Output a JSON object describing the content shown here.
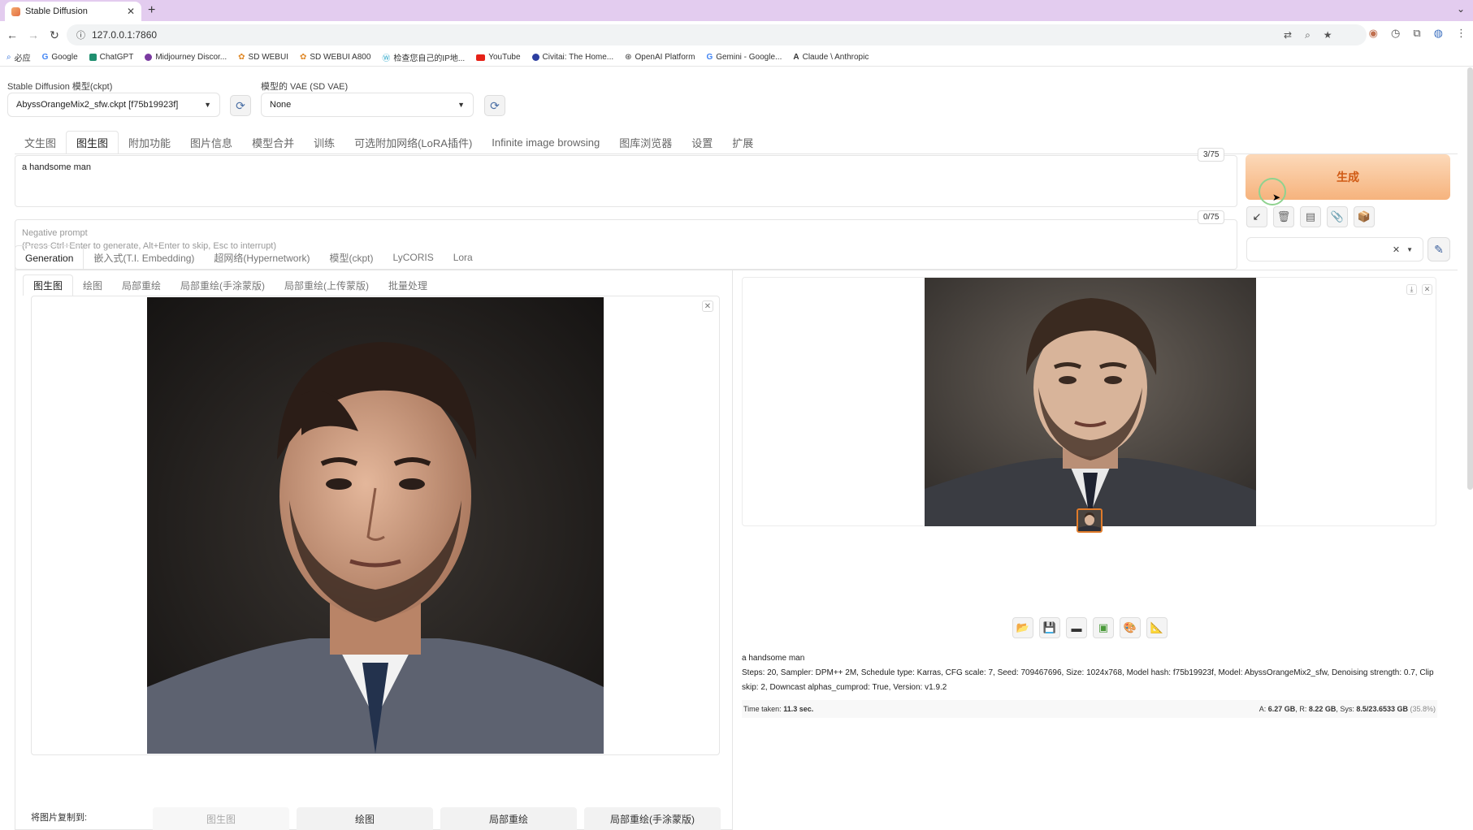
{
  "browser": {
    "tab_title": "Stable Diffusion",
    "url": "127.0.0.1:7860",
    "bookmarks": [
      "必应",
      "Google",
      "ChatGPT",
      "Midjourney Discor...",
      "SD WEBUI",
      "SD WEBUI A800",
      "检查您自己的IP地...",
      "YouTube",
      "Civitai: The Home...",
      "OpenAI Platform",
      "Gemini - Google...",
      "Claude \\ Anthropic"
    ]
  },
  "settings": {
    "model_label": "Stable Diffusion 模型(ckpt)",
    "model_value": "AbyssOrangeMix2_sfw.ckpt [f75b19923f]",
    "vae_label": "模型的 VAE (SD VAE)",
    "vae_value": "None"
  },
  "main_tabs": [
    "文生图",
    "图生图",
    "附加功能",
    "图片信息",
    "模型合并",
    "训练",
    "可选附加网络(LoRA插件)",
    "Infinite image browsing",
    "图库浏览器",
    "设置",
    "扩展"
  ],
  "prompt": {
    "text": "a handsome man",
    "counter": "3/75",
    "negative_placeholder_1": "Negative prompt",
    "negative_placeholder_2": "(Press Ctrl+Enter to generate, Alt+Enter to skip, Esc to interrupt)",
    "negative_counter": "0/75"
  },
  "generate_label": "生成",
  "sub_tabs": [
    "Generation",
    "嵌入式(T.I. Embedding)",
    "超网络(Hypernetwork)",
    "模型(ckpt)",
    "LyCORIS",
    "Lora"
  ],
  "img_tabs": [
    "图生图",
    "绘图",
    "局部重绘",
    "局部重绘(手涂蒙版)",
    "局部重绘(上传蒙版)",
    "批量处理"
  ],
  "copy_to": {
    "label": "将图片复制到:",
    "buttons": [
      "图生图",
      "绘图",
      "局部重绘",
      "局部重绘(手涂蒙版)"
    ]
  },
  "output": {
    "prompt": "a handsome man",
    "params": "Steps: 20, Sampler: DPM++ 2M, Schedule type: Karras, CFG scale: 7, Seed: 709467696, Size: 1024x768, Model hash: f75b19923f, Model: AbyssOrangeMix2_sfw, Denoising strength: 0.7, Clip skip: 2, Downcast alphas_cumprod: True, Version: v1.9.2",
    "time_label": "Time taken:",
    "time_value": "11.3 sec.",
    "mem_a_label": "A:",
    "mem_a": "6.27 GB",
    "mem_r_label": "R:",
    "mem_r": "8.22 GB",
    "mem_sys_label": "Sys:",
    "mem_sys": "8.5/23.6533 GB",
    "mem_pct": "(35.8%)"
  },
  "colors": {
    "accent": "#f6b37d",
    "generate_text": "#d05a14",
    "tab_bar": "#e3ccef"
  }
}
